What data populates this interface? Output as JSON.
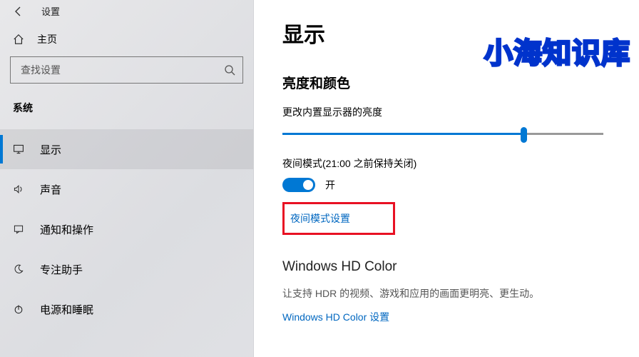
{
  "header": {
    "settings_label": "设置"
  },
  "sidebar": {
    "home_label": "主页",
    "search_placeholder": "查找设置",
    "category_title": "系统",
    "items": [
      {
        "label": "显示"
      },
      {
        "label": "声音"
      },
      {
        "label": "通知和操作"
      },
      {
        "label": "专注助手"
      },
      {
        "label": "电源和睡眠"
      }
    ]
  },
  "main": {
    "page_title": "显示",
    "section_brightness_title": "亮度和颜色",
    "brightness_label": "更改内置显示器的亮度",
    "brightness_value_pct": 75,
    "night_light_label": "夜间模式(21:00 之前保持关闭)",
    "toggle_on_label": "开",
    "night_light_settings_link": "夜间模式设置",
    "hd_color_title": "Windows HD Color",
    "hd_color_desc": "让支持 HDR 的视频、游戏和应用的画面更明亮、更生动。",
    "hd_color_link": "Windows HD Color 设置"
  },
  "watermark_text": "小海知识库"
}
